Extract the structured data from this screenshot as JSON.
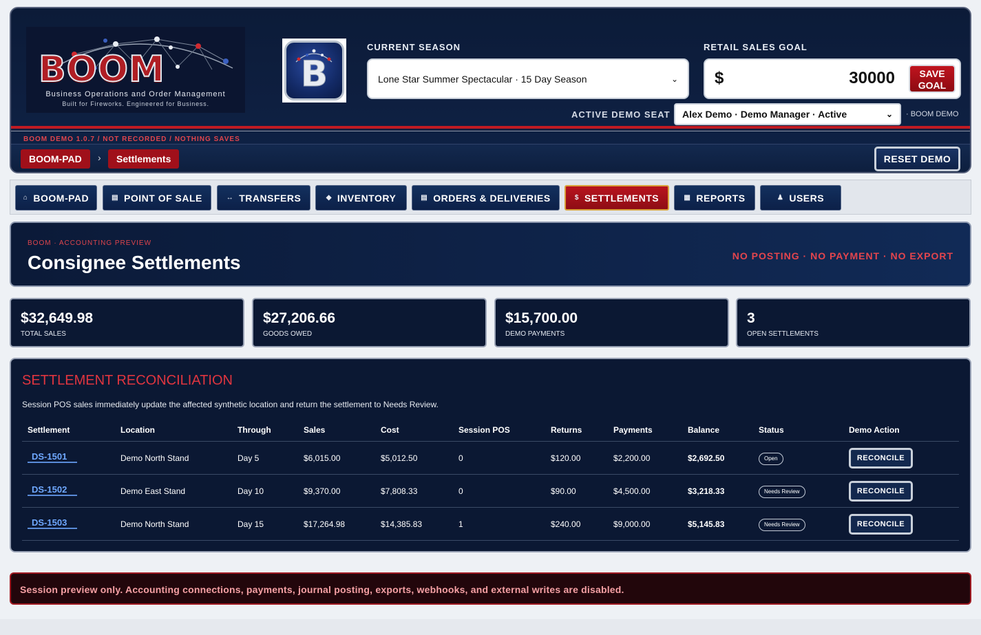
{
  "brand": {
    "logo_word": "BOOM",
    "logo_subtitle": "Business Operations and Order Management",
    "logo_tagline": "Built for Fireworks. Engineered for Business.",
    "badge_letter": "B"
  },
  "season": {
    "label": "CURRENT SEASON",
    "value": "Lone Star Summer Spectacular · 15 Day Season"
  },
  "goal": {
    "label": "RETAIL SALES GOAL",
    "currency": "$",
    "value": "30000",
    "save_label": "SAVE GOAL"
  },
  "seat": {
    "label": "ACTIVE DEMO SEAT",
    "value": "Alex Demo · Demo Manager · Active",
    "tag": "· BOOM DEMO"
  },
  "version_line": "BOOM DEMO 1.0.7 / NOT RECORDED / NOTHING SAVES",
  "breadcrumb": {
    "root": "BOOM-PAD",
    "separator": "›",
    "current": "Settlements"
  },
  "reset_label": "RESET DEMO",
  "nav": {
    "items": [
      {
        "icon": "⌂",
        "label": "BOOM-PAD"
      },
      {
        "icon": "▤",
        "label": "POINT OF SALE"
      },
      {
        "icon": "↔",
        "label": "TRANSFERS"
      },
      {
        "icon": "◆",
        "label": "INVENTORY"
      },
      {
        "icon": "▤",
        "label": "ORDERS & DELIVERIES"
      },
      {
        "icon": "$",
        "label": "SETTLEMENTS"
      },
      {
        "icon": "▦",
        "label": "REPORTS"
      },
      {
        "icon": "♟",
        "label": "USERS"
      }
    ],
    "active": "SETTLEMENTS"
  },
  "page": {
    "kicker": "BOOM · ACCOUNTING PREVIEW",
    "title": "Consignee Settlements",
    "warning": "NO POSTING · NO PAYMENT · NO EXPORT"
  },
  "stats": [
    {
      "value": "$32,649.98",
      "label": "TOTAL SALES"
    },
    {
      "value": "$27,206.66",
      "label": "GOODS OWED"
    },
    {
      "value": "$15,700.00",
      "label": "DEMO PAYMENTS"
    },
    {
      "value": "3",
      "label": "OPEN SETTLEMENTS"
    }
  ],
  "reconciliation": {
    "title": "SETTLEMENT RECONCILIATION",
    "description": "Session POS sales immediately update the affected synthetic location and return the settlement to Needs Review.",
    "columns": [
      "Settlement",
      "Location",
      "Through",
      "Sales",
      "Cost",
      "Session POS",
      "Returns",
      "Payments",
      "Balance",
      "Status",
      "Demo Action"
    ],
    "rows": [
      {
        "id": "DS-1501",
        "location": "Demo North Stand",
        "through": "Day 5",
        "sales": "$6,015.00",
        "cost": "$5,012.50",
        "session_pos": "0",
        "returns": "$120.00",
        "payments": "$2,200.00",
        "balance": "$2,692.50",
        "status": "Open",
        "action": "RECONCILE"
      },
      {
        "id": "DS-1502",
        "location": "Demo East Stand",
        "through": "Day 10",
        "sales": "$9,370.00",
        "cost": "$7,808.33",
        "session_pos": "0",
        "returns": "$90.00",
        "payments": "$4,500.00",
        "balance": "$3,218.33",
        "status": "Needs Review",
        "action": "RECONCILE"
      },
      {
        "id": "DS-1503",
        "location": "Demo North Stand",
        "through": "Day 15",
        "sales": "$17,264.98",
        "cost": "$14,385.83",
        "session_pos": "1",
        "returns": "$240.00",
        "payments": "$9,000.00",
        "balance": "$5,145.83",
        "status": "Needs Review",
        "action": "RECONCILE"
      }
    ]
  },
  "notice": "Session preview only. Accounting connections, payments, journal posting, exports, webhooks, and external writes are disabled.",
  "colors": {
    "navy": "#0b1833",
    "brand_red": "#b8141e",
    "link_blue": "#6fa8ff",
    "warning_red": "#e4454d"
  }
}
